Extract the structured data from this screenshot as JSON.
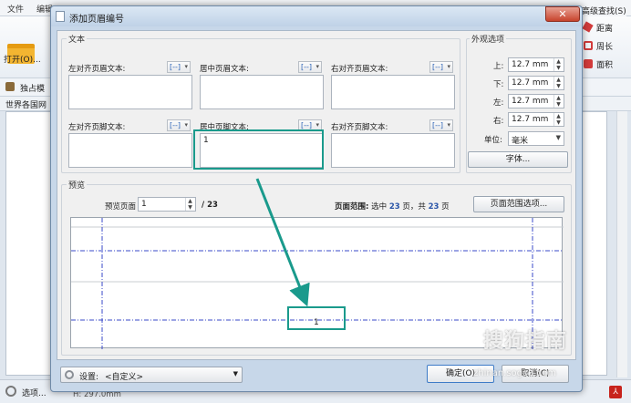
{
  "app": {
    "menu": [
      "文件",
      "编辑"
    ],
    "open_label": "打开(O)...",
    "find_label": "高级查找(S)",
    "toolbar_item": "独占模",
    "doc_tab": "世界各国网",
    "right_tools": [
      "距离",
      "周长",
      "面积"
    ],
    "status_left": "选项...",
    "status_size": "H: 297.0mm"
  },
  "dialog": {
    "title": "添加页眉编号",
    "close": "✕",
    "text_group": {
      "title": "文本",
      "header_left_label": "左对齐页眉文本:",
      "header_center_label": "居中页眉文本:",
      "header_right_label": "右对齐页眉文本:",
      "footer_left_label": "左对齐页脚文本:",
      "footer_center_label": "居中页脚文本:",
      "footer_right_label": "右对齐页脚文本:",
      "header_left_value": "",
      "header_center_value": "",
      "header_right_value": "",
      "footer_left_value": "",
      "footer_center_value": "1",
      "footer_right_value": "",
      "insert_icon": "[--]"
    },
    "appearance": {
      "title": "外观选项",
      "top_label": "上:",
      "bottom_label": "下:",
      "left_label": "左:",
      "right_label": "右:",
      "top": "12.7 mm",
      "bottom": "12.7 mm",
      "left": "12.7 mm",
      "right": "12.7 mm",
      "unit_label": "单位:",
      "unit": "毫米",
      "font_button": "字体..."
    },
    "preview": {
      "title": "预览",
      "page_label": "预览页面",
      "page_value": "1",
      "page_total": "/ 23",
      "range_label": "页面范围:",
      "range_text_1": "选中",
      "range_selected": "23",
      "range_text_2": "页，共",
      "range_total": "23",
      "range_text_3": "页",
      "range_button": "页面范围选项...",
      "sample": "1"
    },
    "settings": {
      "label": "设置:",
      "value": "<自定义>"
    },
    "ok": "确定(O)",
    "cancel": "取消(C)"
  },
  "watermark": {
    "text": "搜狗指南",
    "sub": "zhinan.sogou.com"
  },
  "colors": {
    "highlight": "#1a9a8c",
    "guide_line": "#3a48c8"
  }
}
